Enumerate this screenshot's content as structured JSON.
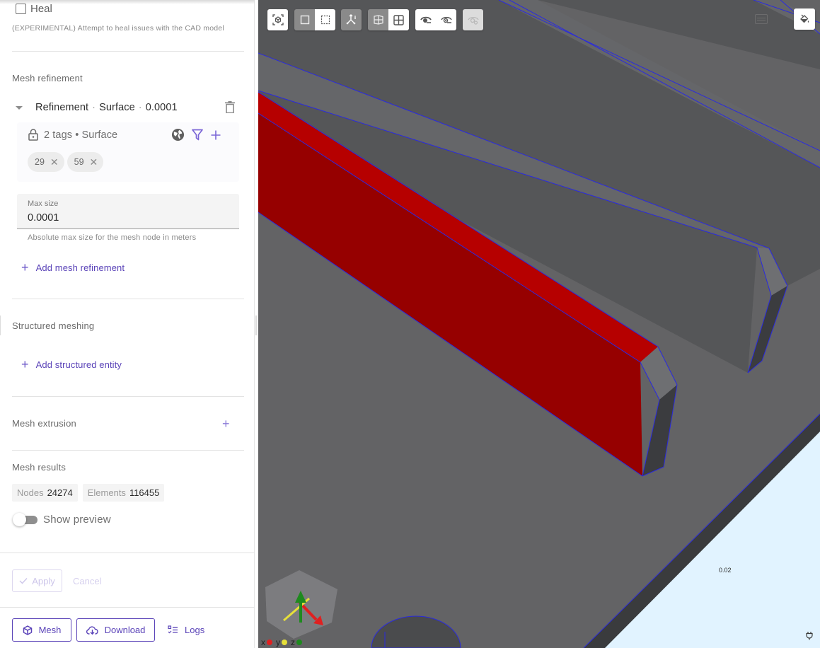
{
  "panel": {
    "heal": {
      "label": "Heal",
      "checked": false,
      "help": "(EXPERIMENTAL) Attempt to heal issues with the CAD model"
    },
    "mesh_refinement": {
      "title": "Mesh refinement",
      "item": {
        "name": "Refinement",
        "type": "Surface",
        "value": "0.0001",
        "separator": "·",
        "tags_summary": "2 tags • Surface",
        "tags": [
          {
            "label": "29"
          },
          {
            "label": "59"
          }
        ],
        "max_size": {
          "label": "Max size",
          "value": "0.0001",
          "help": "Absolute max size for the mesh node in meters"
        }
      },
      "add_label": "Add mesh refinement"
    },
    "structured_meshing": {
      "title": "Structured meshing",
      "add_label": "Add structured entity"
    },
    "mesh_extrusion": {
      "title": "Mesh extrusion"
    },
    "mesh_results": {
      "title": "Mesh results",
      "nodes_label": "Nodes",
      "nodes_value": "24274",
      "elements_label": "Elements",
      "elements_value": "116455",
      "preview_label": "Show preview",
      "preview_on": false
    },
    "actions": {
      "apply": "Apply",
      "cancel": "Cancel"
    },
    "footer": {
      "mesh": "Mesh",
      "download": "Download",
      "logs": "Logs"
    }
  },
  "viewport": {
    "toolbar": [
      {
        "group": "view",
        "items": [
          {
            "icon": "fit-view-icon",
            "state": "normal"
          }
        ]
      },
      {
        "group": "projection",
        "items": [
          {
            "icon": "solid-box-icon",
            "state": "active"
          },
          {
            "icon": "dashed-box-icon",
            "state": "normal"
          }
        ]
      },
      {
        "group": "axes",
        "items": [
          {
            "icon": "axes-info-icon",
            "state": "active"
          }
        ]
      },
      {
        "group": "clip",
        "items": [
          {
            "icon": "clip-plane-icon",
            "state": "active"
          },
          {
            "icon": "grid-icon",
            "state": "normal"
          }
        ]
      },
      {
        "group": "visibility",
        "items": [
          {
            "icon": "eye-hide-icon",
            "state": "normal"
          },
          {
            "icon": "eye-show-icon",
            "state": "normal"
          }
        ]
      },
      {
        "group": "reset",
        "items": [
          {
            "icon": "eye-reset-icon",
            "state": "disabled"
          }
        ]
      }
    ],
    "scale_label": "0.02",
    "axes": [
      {
        "label": "x",
        "color": "#e02020"
      },
      {
        "label": "y",
        "color": "#e6e03a"
      },
      {
        "label": "z",
        "color": "#1e8a1e"
      }
    ],
    "colors": {
      "selected": "#b00000",
      "edge": "#2a2adf",
      "background": "#e1f3ff"
    }
  },
  "theme": {
    "accent": "#5a43b8"
  }
}
